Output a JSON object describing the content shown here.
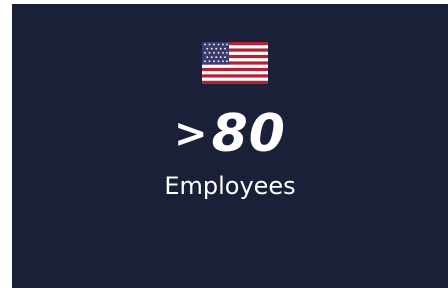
{
  "card": {
    "icon": "us-flag-icon",
    "stat_prefix": ">",
    "stat_value": "80",
    "label": "Employees"
  },
  "colors": {
    "card_background": "#1b2039",
    "text": "#ffffff",
    "flag_red": "#b22234",
    "flag_white": "#ffffff",
    "flag_blue": "#3c3b6e"
  }
}
